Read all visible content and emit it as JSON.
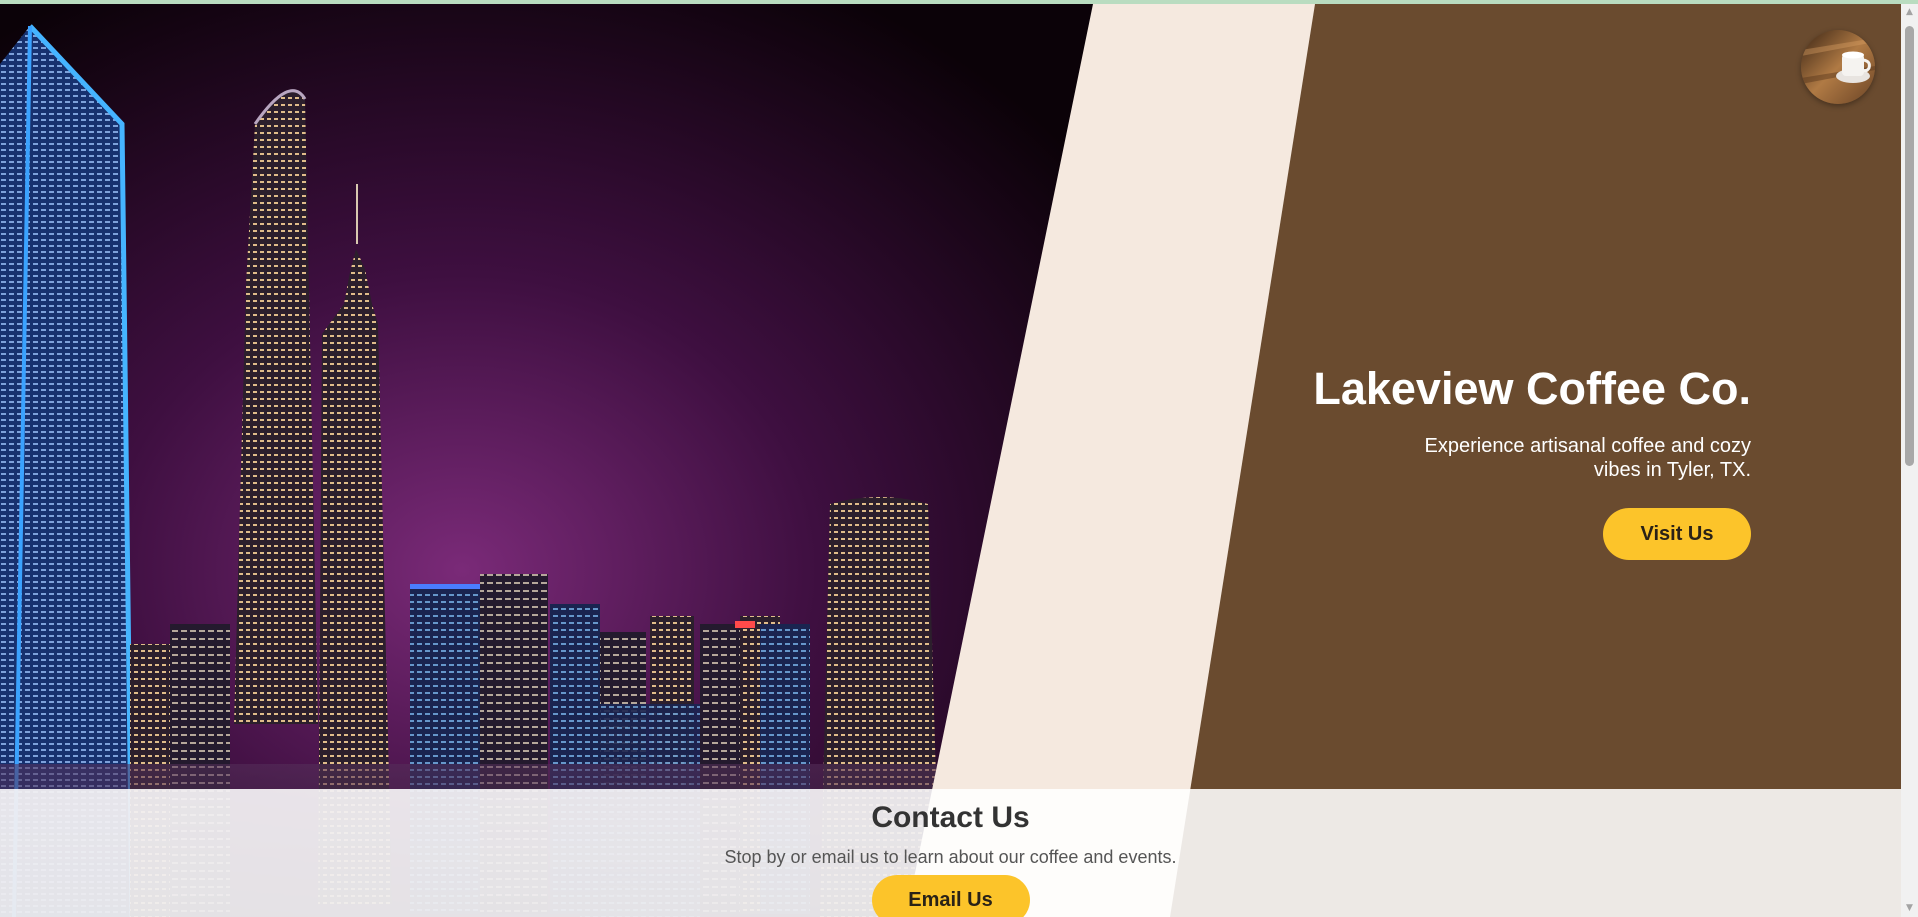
{
  "hero": {
    "title": "Lakeview Coffee Co.",
    "subtitle": "Experience artisanal coffee and cozy vibes in Tyler, TX.",
    "button_label": "Visit Us"
  },
  "contact": {
    "title": "Contact Us",
    "text": "Stop by or email us to learn about our coffee and events.",
    "button_label": "Email Us"
  },
  "colors": {
    "brown_panel": "#6a4b2f",
    "cream_stripe": "#f5e9df",
    "accent_yellow": "#fcc42a",
    "night_sky": "#2a0a2c"
  },
  "icons": {
    "avatar": "coffee-cup-avatar-icon",
    "scroll_up": "chevron-up-icon",
    "scroll_down": "chevron-down-icon"
  }
}
